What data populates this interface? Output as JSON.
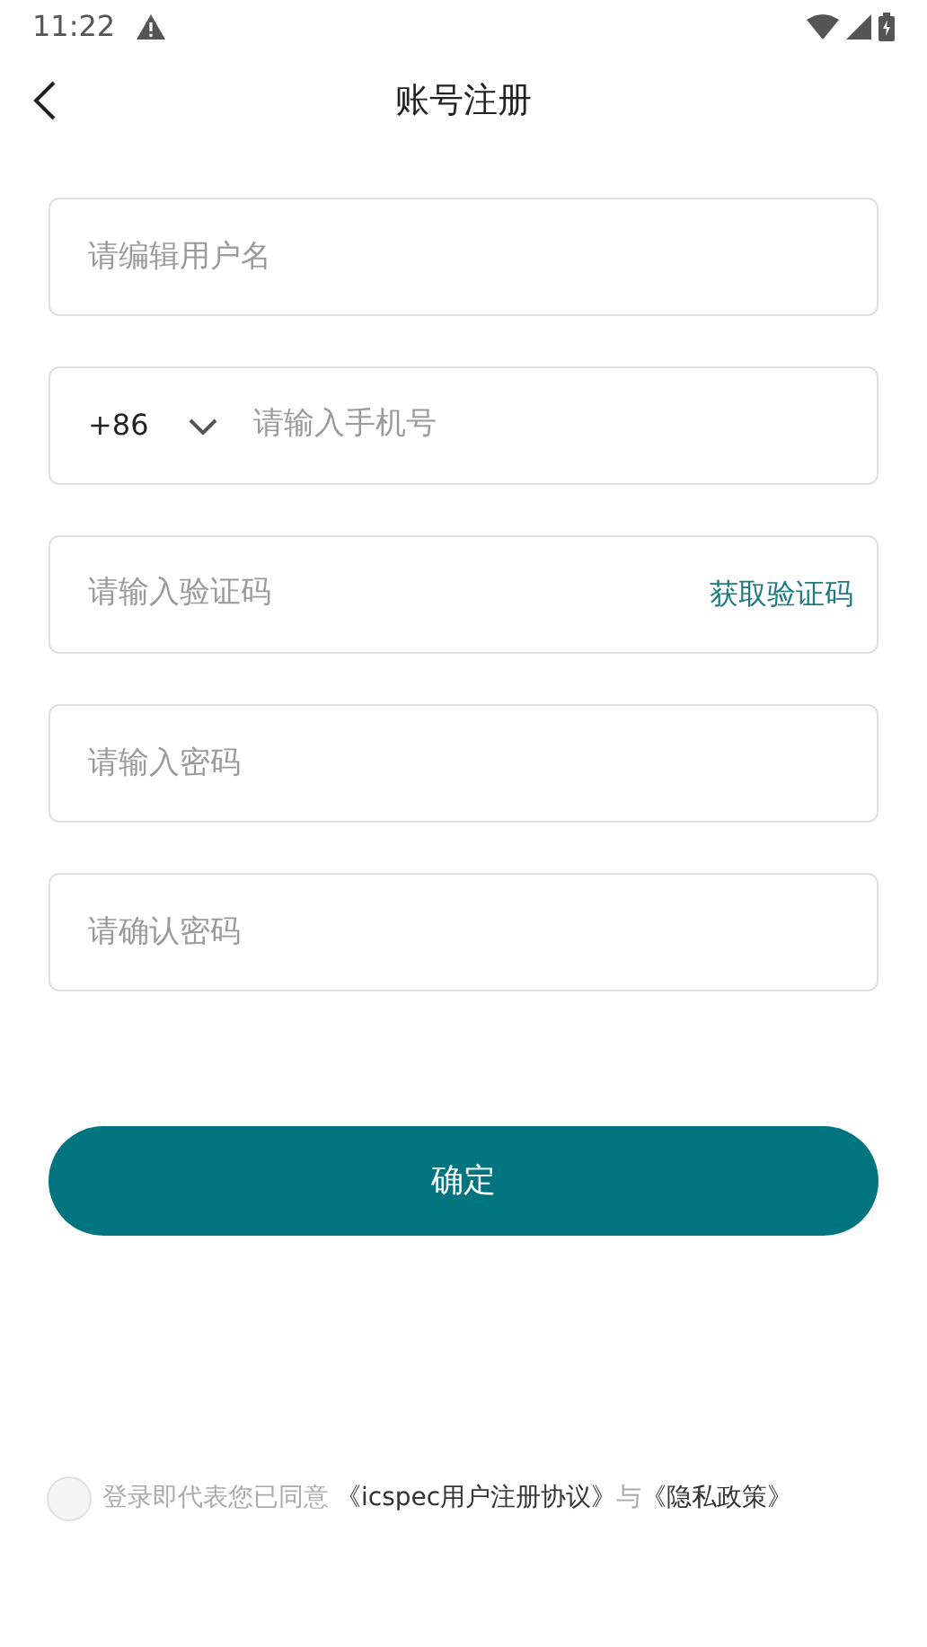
{
  "status_bar": {
    "time": "11:22"
  },
  "header": {
    "title": "账号注册"
  },
  "fields": [
    {
      "kind": "text",
      "placeholder": "请编辑用户名"
    },
    {
      "kind": "phone",
      "country_code": "+86",
      "placeholder": "请输入手机号"
    },
    {
      "kind": "code",
      "placeholder": "请输入验证码",
      "action": "获取验证码"
    },
    {
      "kind": "password",
      "placeholder": "请输入密码"
    },
    {
      "kind": "password",
      "placeholder": "请确认密码"
    }
  ],
  "submit_button": "确定",
  "agreement": {
    "checked": false,
    "prefix": "登录即代表您已同意",
    "terms_link": "《icspec用户注册协议》",
    "conjunction": "与",
    "privacy_link": "《隐私政策》"
  }
}
